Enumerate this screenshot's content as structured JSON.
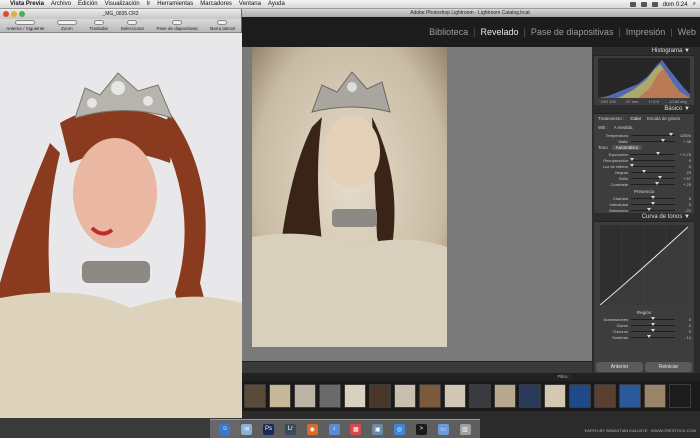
{
  "menubar": {
    "apple": "",
    "items": [
      "Vista Previa",
      "Archivo",
      "Edición",
      "Visualización",
      "Ir",
      "Herramientas",
      "Marcadores",
      "Ventana",
      "Ayuda"
    ],
    "clock": "dom 0:24"
  },
  "lightroom": {
    "window_title": "Adobe Photoshop Lightroom - Lightroom Catalog.lrcat",
    "modules": [
      "Biblioteca",
      "Revelado",
      "Pase de diapositivas",
      "Impresión",
      "Web"
    ],
    "active_module": "Revelado",
    "histogram": {
      "title": "Histograma",
      "values": [
        "ISO 100",
        "67 mm",
        "f / 5.6",
        "1/160 seg"
      ]
    },
    "basic": {
      "title": "Básico",
      "treatment_label": "Tratamiento :",
      "color": "Color",
      "bw": "Escala de grises",
      "wb_label": "WB :",
      "wb_value": "A medida",
      "sliders_wb": [
        {
          "label": "Temperatura",
          "value": "12500",
          "pos": 0.9
        },
        {
          "label": "Matiz",
          "value": "+ 35",
          "pos": 0.72
        }
      ],
      "tone_title": "Tono",
      "tone_auto": "Automático",
      "sliders_tone": [
        {
          "label": "Exposición",
          "value": "+ 0,75",
          "pos": 0.62
        },
        {
          "label": "Recuperación",
          "value": "0",
          "pos": 0.02
        },
        {
          "label": "Luz de relleno",
          "value": "0",
          "pos": 0.02
        },
        {
          "label": "Negros",
          "value": "23",
          "pos": 0.3
        },
        {
          "label": "Brillo",
          "value": "+ 57",
          "pos": 0.65
        },
        {
          "label": "Contraste",
          "value": "+ 25",
          "pos": 0.6
        }
      ],
      "presence_title": "Presencia",
      "sliders_presence": [
        {
          "label": "Claridad",
          "value": "0",
          "pos": 0.5
        },
        {
          "label": "Intensidad",
          "value": "0",
          "pos": 0.5
        },
        {
          "label": "Saturación",
          "value": "- 21",
          "pos": 0.4
        }
      ]
    },
    "tone_curve": {
      "title": "Curva de tonos",
      "region_title": "Región",
      "sliders": [
        {
          "label": "Iluminaciones",
          "value": "0",
          "pos": 0.5
        },
        {
          "label": "Claros",
          "value": "0",
          "pos": 0.5
        },
        {
          "label": "Oscuros",
          "value": "0",
          "pos": 0.5
        },
        {
          "label": "Sombras",
          "value": "- 14",
          "pos": 0.42
        }
      ]
    },
    "buttons": {
      "previous": "Anterior",
      "reset": "Reiniciar"
    },
    "filmstrip": {
      "filter_label": "Filtro :"
    }
  },
  "preview": {
    "window_title": "_MG_0835.CR2",
    "tools": [
      "Anterior / Siguiente",
      "Zoom",
      "Trasladar",
      "Seleccionar",
      "Pase de diapositivas",
      "Barra lateral"
    ]
  },
  "watermark": "EARTH-BY SEBASTIAN KALUZYE · WWW.CRESTOCK.COM",
  "colors": {
    "menubar": "#e6e6e6",
    "lr_bg": "#2b2b2b",
    "panel": "#3d3d3d",
    "accent_active": "#e8e8e8"
  }
}
